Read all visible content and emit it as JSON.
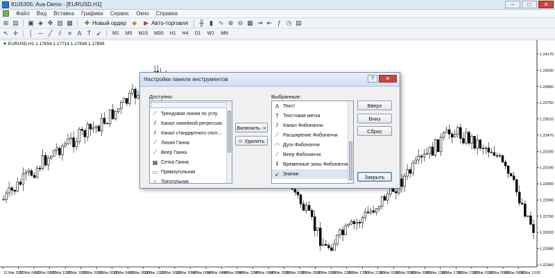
{
  "window": {
    "title": "8105305: Ava-Demo - [EURUSD,H1]",
    "controls": [
      "–",
      "□",
      "✕"
    ]
  },
  "menu": [
    "Файл",
    "Вид",
    "Вставка",
    "Графики",
    "Сервис",
    "Окно",
    "Справка"
  ],
  "toolbar": {
    "new_order": "Новый ордер",
    "auto_trading": "Авто-торговля",
    "timeframes": [
      "M1",
      "M5",
      "M15",
      "M30",
      "H1",
      "H4",
      "D1",
      "W1",
      "MN"
    ]
  },
  "chart": {
    "info": "EURUSD,H1  1.17654 1.17714 1.17638 1.17699",
    "price_labels": [
      "1.24170",
      "1.24030",
      "1.23890",
      "1.23750",
      "1.23610",
      "1.23470",
      "1.23330",
      "1.23190",
      "1.23050",
      "1.22900",
      "1.22760",
      "1.22620",
      "1.22480",
      "1.22340"
    ],
    "time_labels": [
      "12 Mar 2018",
      "12 Mar 04:00",
      "12 Mar 08:00",
      "12 Mar 12:00",
      "12 Mar 16:00",
      "12 Mar 20:00",
      "13 Mar 00:00",
      "13 Mar 04:00",
      "13 Mar 08:00",
      "13 Mar 12:00",
      "13 Mar 16:00",
      "13 Mar 20:00",
      "14 Mar 00:00",
      "14 Mar 04:00",
      "14 Mar 08:00",
      "14 Mar 12:00",
      "14 Mar 16:00",
      "14 Mar 20:00",
      "15 Mar 01:00",
      "15 Mar 05:00",
      "15 Mar 09:00",
      "15 Mar 13:00",
      "15 Mar 17:00",
      "15 Mar 21:00",
      "16 Mar 01:00",
      "16 Mar 05:00",
      "16 Mar 09:00",
      "16 Mar 13:00",
      "16 Mar 17:00",
      "16 Mar 21:00",
      "19 Mar 01:00",
      "19 Mar 05:00",
      "19 Mar 09:00",
      "19 Mar 13:00"
    ]
  },
  "dialog": {
    "title": "Настройки панели инструментов",
    "help": "?",
    "close": "✕",
    "available_label": "Доступно:",
    "selected_label": "Выбранные:",
    "available": [
      {
        "icon": "trendline-angle-icon",
        "glyph": "⟋",
        "label": "Трендовая линия по углу"
      },
      {
        "icon": "regression-channel-icon",
        "glyph": "⫽",
        "label": "Канал линейной регрессии"
      },
      {
        "icon": "stddev-channel-icon",
        "glyph": "⫽",
        "label": "Канал стандартного откл..."
      },
      {
        "icon": "gann-line-icon",
        "glyph": "⟋",
        "label": "Линия Ганна"
      },
      {
        "icon": "gann-fan-icon",
        "glyph": "⟋",
        "label": "Веер Ганна"
      },
      {
        "icon": "gann-grid-icon",
        "glyph": "▦",
        "label": "Сетка Ганна"
      },
      {
        "icon": "rectangle-icon",
        "glyph": "▭",
        "label": "Прямоугольник"
      },
      {
        "icon": "triangle-icon",
        "glyph": "△",
        "label": "Треугольник"
      }
    ],
    "selected": [
      {
        "icon": "text-icon",
        "glyph": "A",
        "label": "Текст"
      },
      {
        "icon": "text-label-icon",
        "glyph": "T",
        "label": "Текстовая метка"
      },
      {
        "icon": "fibo-channel-icon",
        "glyph": "⫽",
        "label": "Канал Фибоначчи"
      },
      {
        "icon": "fibo-extension-icon",
        "glyph": "⟋",
        "label": "Расширение Фибоначчи"
      },
      {
        "icon": "fibo-arcs-icon",
        "glyph": "◠",
        "label": "Дуги Фибоначчи"
      },
      {
        "icon": "fibo-fan-icon",
        "glyph": "⟋",
        "label": "Веер Фибоначчи"
      },
      {
        "icon": "fibo-timezones-icon",
        "glyph": "⦀",
        "label": "Временные зоны Фибоначчи"
      },
      {
        "icon": "arrows-icon",
        "glyph": "➹",
        "label": "Значки"
      }
    ],
    "include_button": "Включить ->",
    "remove_button": "<- Удалить",
    "up_button": "Вверх",
    "down_button": "Вниз",
    "reset_button": "Сброс",
    "close_button": "Закрыть"
  }
}
